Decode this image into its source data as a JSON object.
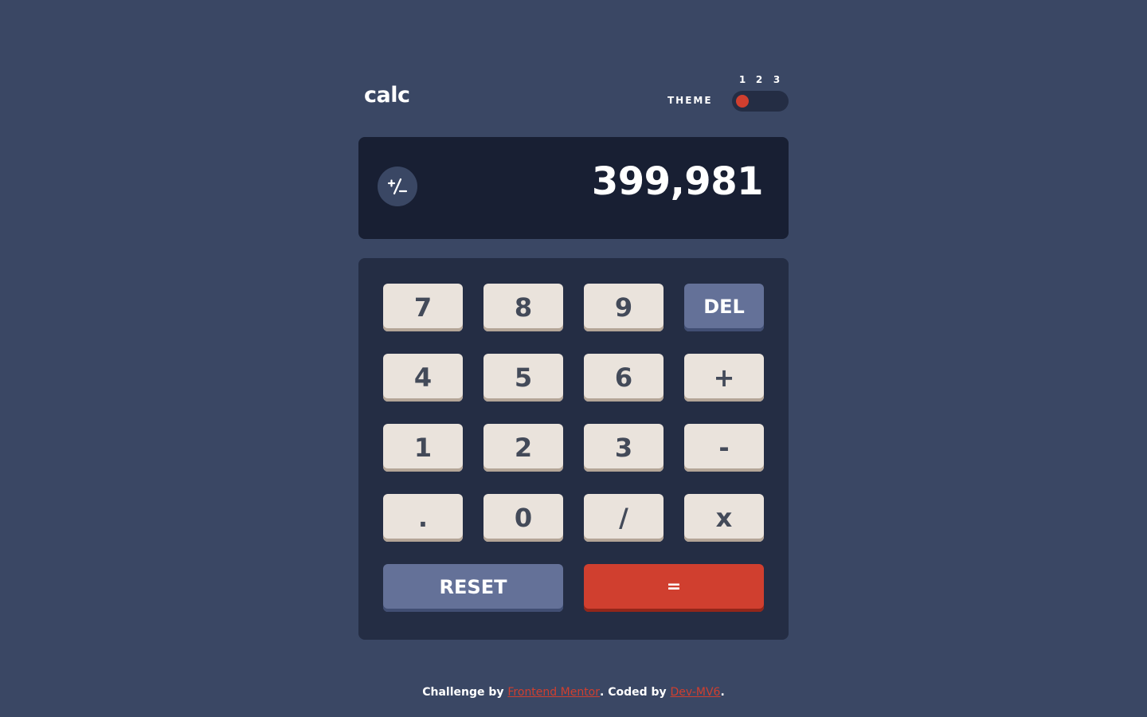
{
  "header": {
    "logo": "calc",
    "theme_label": "THEME",
    "theme_options": [
      "1",
      "2",
      "3"
    ],
    "selected_theme": 1
  },
  "screen": {
    "display_value": "399,981",
    "sign_toggle_icon": "plus-minus-icon"
  },
  "keypad": {
    "keys": [
      "7",
      "8",
      "9",
      "DEL",
      "4",
      "5",
      "6",
      "+",
      "1",
      "2",
      "3",
      "-",
      ".",
      "0",
      "/",
      "x"
    ],
    "reset_label": "RESET",
    "equals_label": "="
  },
  "footer": {
    "prefix": "Challenge by ",
    "link1": "Frontend Mentor",
    "middle": ". Coded by ",
    "link2": "Dev-MV6",
    "suffix": "."
  },
  "colors": {
    "background": "#3a4764",
    "screen": "#181f33",
    "keypad": "#242d44",
    "key": "#eae3dc",
    "key_text": "#434a59",
    "accent_blue": "#647198",
    "accent_red": "#d03f2f"
  }
}
